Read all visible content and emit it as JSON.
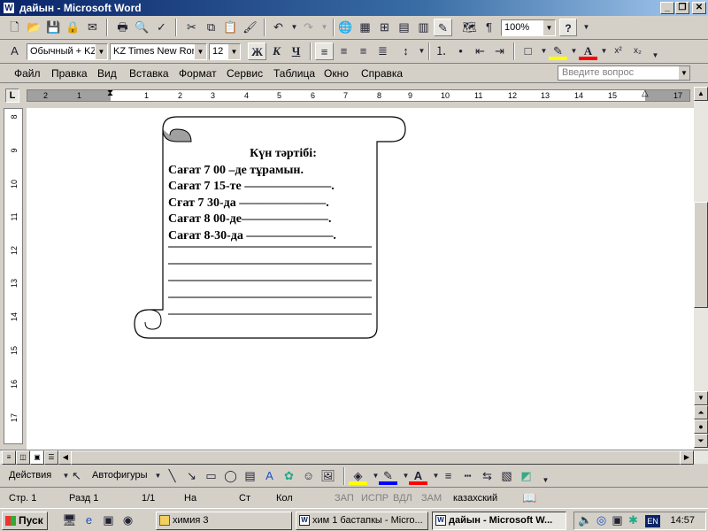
{
  "window": {
    "title": "дайын - Microsoft Word",
    "app_icon": "W"
  },
  "formatting": {
    "style": "Обычный + KZ",
    "font": "KZ Times New Roma",
    "size": "12",
    "bold": "Ж",
    "italic": "К",
    "underline": "Ч",
    "superscript": "x²",
    "subscript": "x₂"
  },
  "standard": {
    "zoom": "100%",
    "help": "?"
  },
  "menu": {
    "items": [
      "Файл",
      "Правка",
      "Вид",
      "Вставка",
      "Формат",
      "Сервис",
      "Таблица",
      "Окно",
      "Справка"
    ],
    "help_placeholder": "Введите вопрос"
  },
  "ruler": {
    "h_numbers": [
      "2",
      "1",
      "1",
      "2",
      "3",
      "4",
      "5",
      "6",
      "7",
      "8",
      "9",
      "10",
      "11",
      "12",
      "13",
      "14",
      "15",
      "17"
    ],
    "v_numbers": [
      "8",
      "9",
      "10",
      "11",
      "12",
      "13",
      "14",
      "15",
      "16",
      "17"
    ]
  },
  "document": {
    "title": "Күн тәртібі:",
    "lines": [
      "Сағат 7 00 –де тұрамын.",
      "Сағат 7 15-те ———————.",
      "Сғат 7 30-да ———————.",
      "Сағат 8  00-де———————.",
      "Сағат 8-30-да ———————."
    ]
  },
  "drawing": {
    "actions": "Действия",
    "autoshapes": "Автофигуры"
  },
  "status": {
    "page": "Стр.  1",
    "section": "Разд  1",
    "pages": "1/1",
    "at": "На",
    "line": "Ст",
    "col": "Кол",
    "rec": "ЗАП",
    "trk": "ИСПР",
    "ext": "ВДЛ",
    "ovr": "ЗАМ",
    "language": "казахский"
  },
  "taskbar": {
    "start": "Пуск",
    "buttons": [
      {
        "label": "химия 3",
        "active": false
      },
      {
        "label": "хим 1 бастапкы - Micro...",
        "active": false
      },
      {
        "label": "дайын - Microsoft W...",
        "active": true
      }
    ],
    "lang": "EN",
    "clock": "14:57"
  },
  "colors": {
    "titlebar_start": "#0a246a",
    "titlebar_end": "#a6caf0",
    "chrome": "#d4d0c8",
    "highlight": "#ffff00",
    "font_color": "#ff0000"
  }
}
